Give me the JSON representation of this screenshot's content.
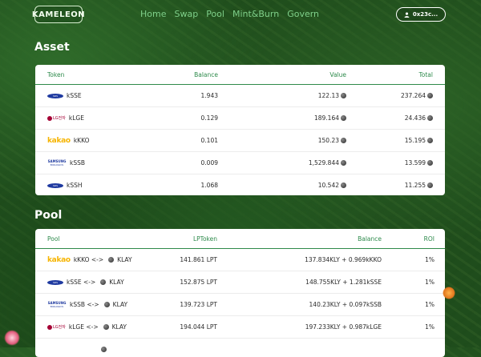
{
  "nav": {
    "logo": "KAMELEON",
    "links": [
      "Home",
      "Swap",
      "Pool",
      "Mint&Burn",
      "Govern"
    ],
    "wallet": "0x23c..."
  },
  "asset": {
    "title": "Asset",
    "headers": [
      "Token",
      "Balance",
      "Value",
      "Total"
    ],
    "rows": [
      {
        "logo": "samsung-sds-logo",
        "logo_text": "SDS",
        "token": "kSSE",
        "balance": "1.943",
        "value": "122.13",
        "total": "237.264"
      },
      {
        "logo": "lg-electronics-logo",
        "logo_text": "LG전자",
        "token": "kLGE",
        "balance": "0.129",
        "value": "189.164",
        "total": "24.436"
      },
      {
        "logo": "kakao-logo",
        "logo_text": "kakao",
        "token": "kKKO",
        "balance": "0.101",
        "value": "150.23",
        "total": "15.195"
      },
      {
        "logo": "samsung-biologics-logo",
        "logo_text": "SAMSUNG",
        "logo_sub": "BIOLOGICS",
        "token": "kSSB",
        "balance": "0.009",
        "value": "1,529.844",
        "total": "13.599"
      },
      {
        "logo": "samsung-sds-logo",
        "logo_text": "SDS",
        "token": "kSSH",
        "balance": "1.068",
        "value": "10.542",
        "total": "11.255"
      }
    ]
  },
  "pool": {
    "title": "Pool",
    "headers": [
      "Pool",
      "LPToken",
      "Balance",
      "ROI"
    ],
    "rows": [
      {
        "logo": "kakao-logo",
        "logo_text": "kakao",
        "pair_left": "kKKO <->",
        "pair_right": "KLAY",
        "lp": "141.861 LPT",
        "balance": "137.834KLY + 0.969kKKO",
        "roi": "1%"
      },
      {
        "logo": "samsung-sds-logo",
        "logo_text": "SDS",
        "pair_left": "kSSE <->",
        "pair_right": "KLAY",
        "lp": "152.875 LPT",
        "balance": "148.755KLY + 1.281kSSE",
        "roi": "1%"
      },
      {
        "logo": "samsung-biologics-logo",
        "logo_text": "SAMSUNG",
        "logo_sub": "BIOLOGICS",
        "pair_left": "kSSB <->",
        "pair_right": "KLAY",
        "lp": "139.723 LPT",
        "balance": "140.23KLY + 0.097kSSB",
        "roi": "1%"
      },
      {
        "logo": "lg-electronics-logo",
        "logo_text": "LG전자",
        "pair_left": "kLGE <->",
        "pair_right": "KLAY",
        "lp": "194.044 LPT",
        "balance": "197.233KLY + 0.987kLGE",
        "roi": "1%"
      },
      {
        "logo": "",
        "logo_text": "",
        "pair_left": "",
        "pair_right": "",
        "lp": "",
        "balance": "",
        "roi": ""
      }
    ]
  },
  "colors": {
    "accent": "#2d8a4b",
    "nav_link": "#7fd08a",
    "card_bg": "#ffffff"
  }
}
